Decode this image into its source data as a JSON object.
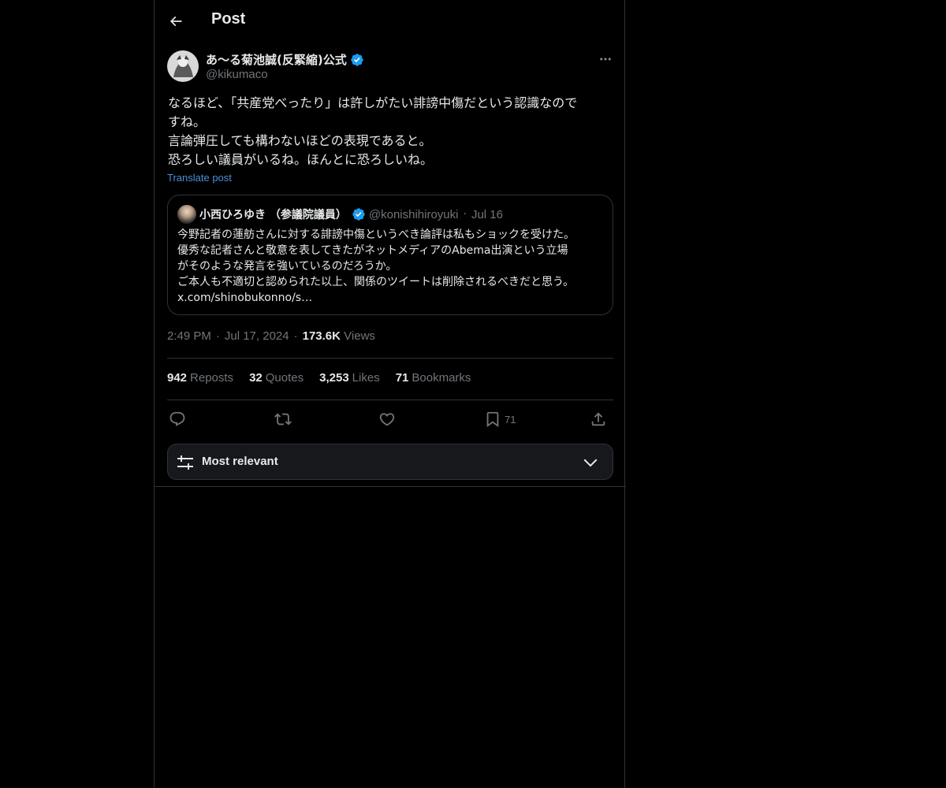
{
  "header": {
    "title": "Post"
  },
  "post": {
    "author_name": "あ〜る菊池誠(反緊縮)公式",
    "author_handle": "@kikumaco",
    "text_lines": [
      "なるほど、「共産党べったり」は許しがたい誹謗中傷だという認識なので",
      "すね。",
      "言論弾圧しても構わないほどの表現であると。",
      "恐ろしい議員がいるね。ほんとに恐ろしいね。"
    ],
    "translate_label": "Translate post",
    "time": "2:49 PM",
    "date": "Jul 17, 2024",
    "views_count": "173.6K",
    "views_label": "Views"
  },
  "quote": {
    "author_name": "小西ひろゆき （参議院議員）",
    "author_handle": "@konishihiroyuki",
    "date": "Jul 16",
    "text_lines": [
      "今野記者の蓮舫さんに対する誹謗中傷というべき論評は私もショックを受けた。",
      "優秀な記者さんと敬意を表してきたがネットメディアのAbema出演という立場",
      "がそのような発言を強いているのだろうか。",
      "ご本人も不適切と認められた以上、関係のツイートは削除されるべきだと思う。",
      "x.com/shinobukonno/s…"
    ]
  },
  "stats": {
    "reposts_count": "942",
    "reposts_label": "Reposts",
    "quotes_count": "32",
    "quotes_label": "Quotes",
    "likes_count": "3,253",
    "likes_label": "Likes",
    "bookmarks_count": "71",
    "bookmarks_label": "Bookmarks"
  },
  "actions": {
    "bookmark_count": "71",
    "icons": [
      "reply-icon",
      "repost-icon",
      "like-icon",
      "bookmark-icon",
      "share-icon"
    ]
  },
  "sort": {
    "label": "Most relevant"
  },
  "colors": {
    "background": "#000000",
    "text": "#e7e9ea",
    "muted": "#71767b",
    "border": "#2f3336",
    "link": "#1d9bf0",
    "verified": "#1d9bf0"
  }
}
